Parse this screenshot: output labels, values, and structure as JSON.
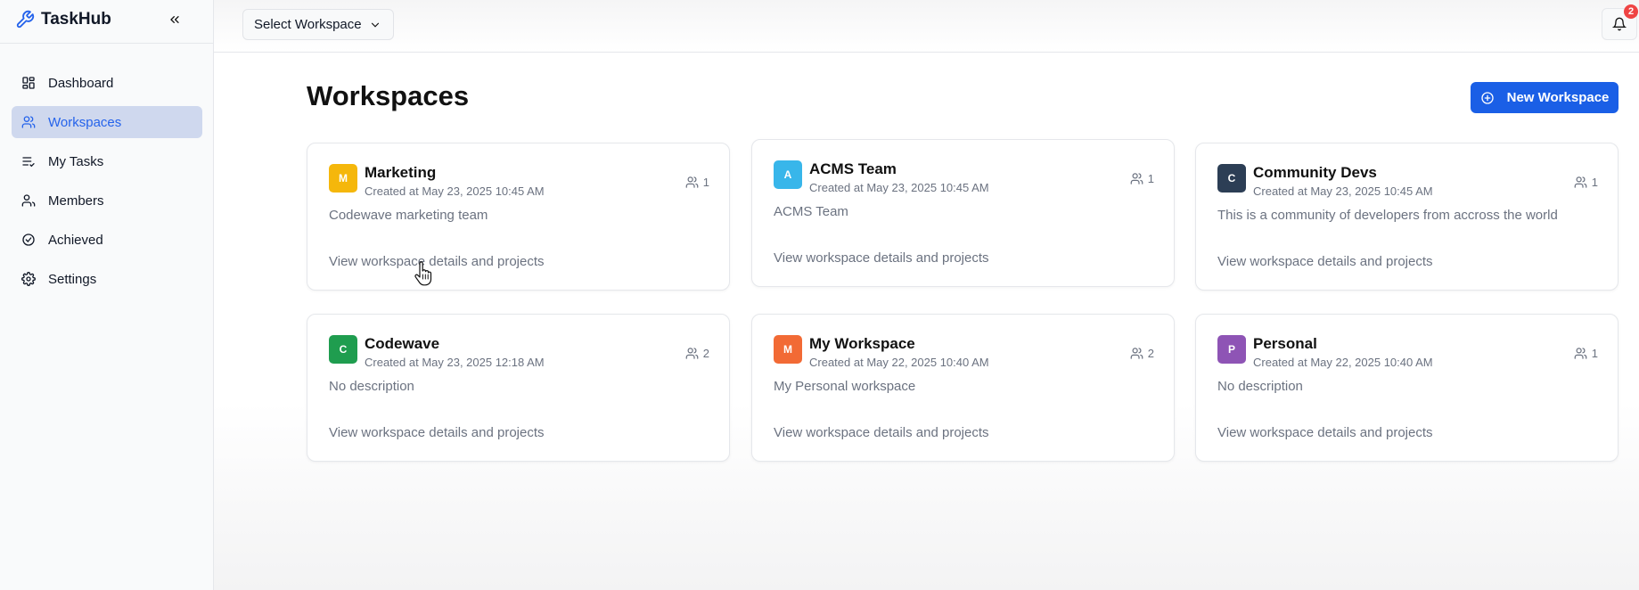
{
  "app": {
    "name": "TaskHub"
  },
  "sidebar": {
    "items": [
      {
        "label": "Dashboard",
        "icon": "dashboard-icon",
        "active": false
      },
      {
        "label": "Workspaces",
        "icon": "users-icon",
        "active": true
      },
      {
        "label": "My Tasks",
        "icon": "list-check-icon",
        "active": false
      },
      {
        "label": "Members",
        "icon": "user-icon",
        "active": false
      },
      {
        "label": "Achieved",
        "icon": "check-circle-icon",
        "active": false
      },
      {
        "label": "Settings",
        "icon": "gear-icon",
        "active": false
      }
    ]
  },
  "topbar": {
    "workspace_select": "Select Workspace",
    "notification_count": "2"
  },
  "main": {
    "title": "Workspaces",
    "new_button": "New Workspace",
    "link_text": "View workspace details and projects",
    "workspaces": [
      {
        "initial": "M",
        "name": "Marketing",
        "created": "Created at May 23, 2025 10:45 AM",
        "members": "1",
        "description": "Codewave marketing team",
        "color": "#f5b70b"
      },
      {
        "initial": "A",
        "name": "ACMS Team",
        "created": "Created at May 23, 2025 10:45 AM",
        "members": "1",
        "description": "ACMS Team",
        "color": "#38b6ea"
      },
      {
        "initial": "C",
        "name": "Community Devs",
        "created": "Created at May 23, 2025 10:45 AM",
        "members": "1",
        "description": "This is a community of developers from accross the world",
        "color": "#2c3e55"
      },
      {
        "initial": "C",
        "name": "Codewave",
        "created": "Created at May 23, 2025 12:18 AM",
        "members": "2",
        "description": "No description",
        "color": "#1f9d4f"
      },
      {
        "initial": "M",
        "name": "My Workspace",
        "created": "Created at May 22, 2025 10:40 AM",
        "members": "2",
        "description": "My Personal workspace",
        "color": "#f26a35"
      },
      {
        "initial": "P",
        "name": "Personal",
        "created": "Created at May 22, 2025 10:40 AM",
        "members": "1",
        "description": "No description",
        "color": "#8e54b5"
      }
    ]
  },
  "colors": {
    "accent": "#1a5fe6",
    "active_nav_bg": "#cfd8ee",
    "badge": "#ef4444"
  }
}
